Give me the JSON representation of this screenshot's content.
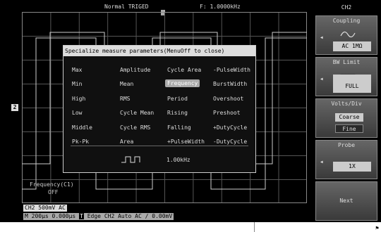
{
  "topbar": {
    "trigger_status": "Normal TRIGED",
    "frequency": "F: 1.0000kHz"
  },
  "channel_marker": "2",
  "dialog": {
    "title": "Specialize measure parameters(MenuOff to close)",
    "rows": [
      [
        "Max",
        "Amplitude",
        "Cycle Area",
        "-PulseWidth"
      ],
      [
        "Min",
        "Mean",
        "Frequency",
        "BurstWidth"
      ],
      [
        "High",
        "RMS",
        "Period",
        "Overshoot"
      ],
      [
        "Low",
        "Cycle Mean",
        "Rising",
        "Preshoot"
      ],
      [
        "Middle",
        "Cycle RMS",
        "Falling",
        "+DutyCycle"
      ],
      [
        "Pk-Pk",
        "Area",
        "+PulseWidth",
        "-DutyCycle"
      ]
    ],
    "selected": "Frequency",
    "preview_value": "1.00kHz"
  },
  "measure": {
    "label": "Frequency(C1)",
    "value": "OFF"
  },
  "status": {
    "channel": "CH2 500mV AC",
    "timebase": "M 200μs 0.000μs",
    "trigger_badge": "T",
    "trigger_info": "Edge CH2 Auto AC ∕ 0.00mV"
  },
  "menu": {
    "title": "CH2",
    "coupling": {
      "label": "Coupling",
      "value": "AC 1MΩ",
      "icon": "ac-sine-icon"
    },
    "bw_limit": {
      "label": "BW Limit",
      "value": "FULL",
      "icon": "bw-limit-icon"
    },
    "volts_div": {
      "label": "Volts/Div",
      "coarse": "Coarse",
      "fine": "Fine"
    },
    "probe": {
      "label": "Probe",
      "value": "1X"
    },
    "next": "Next"
  }
}
